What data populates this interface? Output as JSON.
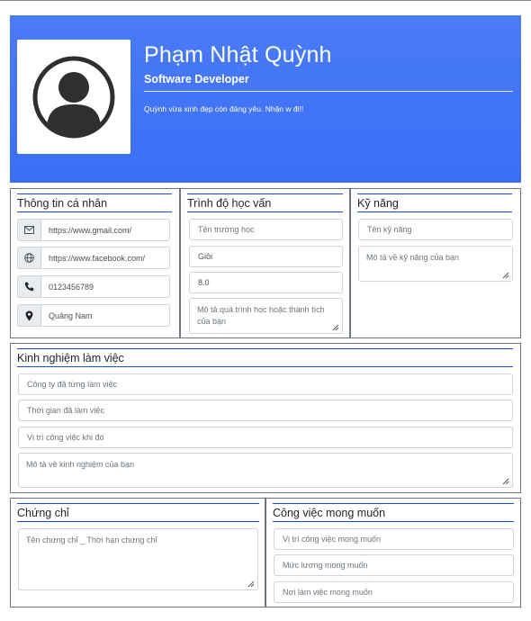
{
  "profile": {
    "name": "Phạm Nhật Quỳnh",
    "role": "Software Developer",
    "bio": "Quỳnh vừa xinh đẹp còn đáng yêu. Nhận w đi!!",
    "avatar_icon": "user-avatar-icon"
  },
  "personal": {
    "title": "Thông tin cá nhân",
    "email": "https://www.gmail.com/",
    "website": "https://www.facebook.com/",
    "phone": "0123456789",
    "address": "Quảng Nam"
  },
  "education": {
    "title": "Trình độ học vấn",
    "school_placeholder": "Tên trường học",
    "rank_value": "Giỏi",
    "gpa_value": "8.0",
    "desc_placeholder": "Mô tả quá trình học hoặc thành tích của bạn"
  },
  "skills": {
    "title": "Kỹ năng",
    "name_placeholder": "Tên kỹ năng",
    "desc_placeholder": "Mô tả về kỹ năng của bạn"
  },
  "experience": {
    "title": "Kinh nghiệm làm việc",
    "company_placeholder": "Công ty đã từng làm việc",
    "time_placeholder": "Thời gian đã làm việc",
    "position_placeholder": "Vị trí công việc khi đó",
    "desc_placeholder": "Mô tả về kinh nghiệm của bạn"
  },
  "certificates": {
    "title": "Chứng chỉ",
    "placeholder": "Tên chứng chỉ _ Thời hạn chứng chỉ"
  },
  "desired_job": {
    "title": "Công việc mong muốn",
    "position_placeholder": "Vị trí công việc mong muốn",
    "salary_placeholder": "Mức lương mong muốn",
    "location_placeholder": "Nơi làm việc mong muốn"
  },
  "colors": {
    "header_blue": "#3b6ef7",
    "rule_blue": "#1e4fd8"
  }
}
